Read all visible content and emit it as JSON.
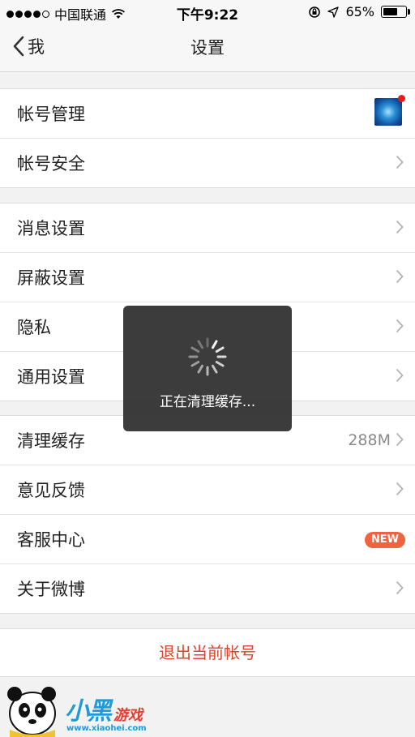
{
  "status_bar": {
    "carrier": "中国联通",
    "time": "下午9:22",
    "battery_percent": "65%",
    "battery_level": 0.65
  },
  "nav": {
    "back_label": "我",
    "title": "设置"
  },
  "groups": [
    {
      "items": [
        {
          "label": "帐号管理",
          "accessory": "avatar"
        },
        {
          "label": "帐号安全",
          "accessory": "chevron"
        }
      ]
    },
    {
      "items": [
        {
          "label": "消息设置",
          "accessory": "chevron"
        },
        {
          "label": "屏蔽设置",
          "accessory": "chevron"
        },
        {
          "label": "隐私",
          "accessory": "chevron"
        },
        {
          "label": "通用设置",
          "accessory": "chevron"
        }
      ]
    },
    {
      "items": [
        {
          "label": "清理缓存",
          "value": "288M",
          "accessory": "chevron"
        },
        {
          "label": "意见反馈",
          "accessory": "chevron"
        },
        {
          "label": "客服中心",
          "badge": "NEW"
        },
        {
          "label": "关于微博",
          "accessory": "chevron"
        }
      ]
    }
  ],
  "logout_label": "退出当前帐号",
  "toast": {
    "message": "正在清理缓存..."
  },
  "watermark": {
    "brand": "小黑",
    "brand2": "游戏",
    "url": "www.xiaohei.com"
  },
  "colors": {
    "accent_red": "#e2412b",
    "badge": "#f06340",
    "watermark_blue": "#1d9be0"
  }
}
